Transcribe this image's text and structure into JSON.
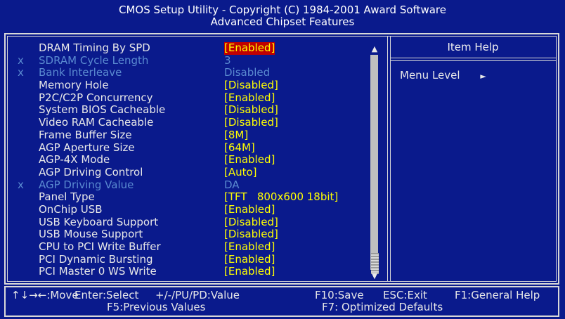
{
  "title": {
    "line1": "CMOS Setup Utility - Copyright (C) 1984-2001 Award Software",
    "line2": "Advanced Chipset Features"
  },
  "settings": [
    {
      "disabled": false,
      "label": "DRAM Timing By SPD",
      "value": "[Enabled]",
      "selected": true
    },
    {
      "disabled": true,
      "label": "SDRAM Cycle Length",
      "value": "3"
    },
    {
      "disabled": true,
      "label": "Bank Interleave",
      "value": "Disabled"
    },
    {
      "disabled": false,
      "label": "Memory Hole",
      "value": "[Disabled]"
    },
    {
      "disabled": false,
      "label": "P2C/C2P Concurrency",
      "value": "[Enabled]"
    },
    {
      "disabled": false,
      "label": "System BIOS Cacheable",
      "value": "[Disabled]"
    },
    {
      "disabled": false,
      "label": "Video RAM Cacheable",
      "value": "[Disabled]"
    },
    {
      "disabled": false,
      "label": "Frame Buffer Size",
      "value": "[8M]"
    },
    {
      "disabled": false,
      "label": "AGP Aperture Size",
      "value": "[64M]"
    },
    {
      "disabled": false,
      "label": "AGP-4X Mode",
      "value": "[Enabled]"
    },
    {
      "disabled": false,
      "label": "AGP Driving Control",
      "value": "[Auto]"
    },
    {
      "disabled": true,
      "label": "AGP Driving Value",
      "value": "DA"
    },
    {
      "disabled": false,
      "label": "Panel Type",
      "value": "[TFT   800x600 18bit]"
    },
    {
      "disabled": false,
      "label": "OnChip USB",
      "value": "[Enabled]"
    },
    {
      "disabled": false,
      "label": "USB Keyboard Support",
      "value": "[Disabled]"
    },
    {
      "disabled": false,
      "label": "USB Mouse Support",
      "value": "[Disabled]"
    },
    {
      "disabled": false,
      "label": "CPU to PCI Write Buffer",
      "value": "[Enabled]"
    },
    {
      "disabled": false,
      "label": "PCI Dynamic Bursting",
      "value": "[Enabled]"
    },
    {
      "disabled": false,
      "label": "PCI Master 0 WS Write",
      "value": "[Enabled]"
    }
  ],
  "help": {
    "title": "Item Help",
    "menu_level": "Menu Level",
    "menu_level_arrow": "►"
  },
  "scrollbar": {
    "up": "▲",
    "down": "▼"
  },
  "footer": {
    "move": "↑↓→←:Move",
    "enter": "Enter:Select",
    "value": "+/-/PU/PD:Value",
    "save": "F10:Save",
    "exit": "ESC:Exit",
    "help": "F1:General Help",
    "prev": "F5:Previous Values",
    "opt": "F7: Optimized Defaults"
  },
  "colors": {
    "background": "#0a1a8c",
    "disabled_text": "#5a8ad0",
    "value_text": "#ffff00",
    "highlight_bg": "#c00000"
  }
}
